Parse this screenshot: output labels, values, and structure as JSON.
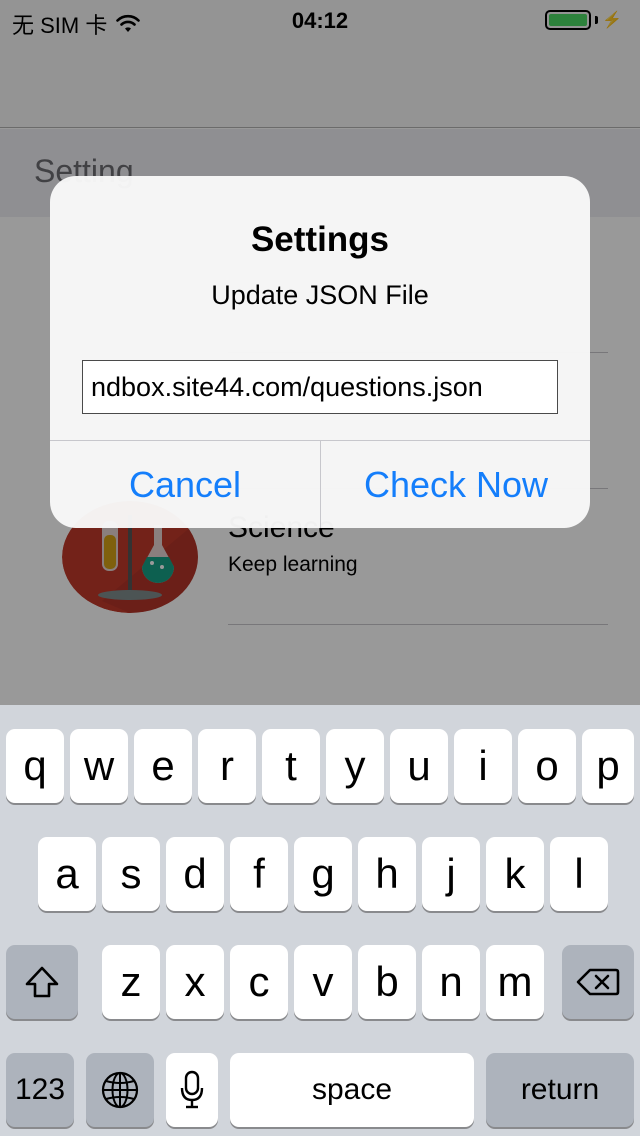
{
  "status_bar": {
    "carrier": "无 SIM 卡",
    "time": "04:12",
    "battery_color": "#4cd964"
  },
  "content": {
    "section_title": "Setting",
    "cells": [
      {
        "title": "Science",
        "subtitle": "Keep learning",
        "icon": "science-lab-icon"
      }
    ]
  },
  "alert": {
    "title": "Settings",
    "message": "Update JSON File",
    "input_value": "ndbox.site44.com/questions.json",
    "cancel_label": "Cancel",
    "confirm_label": "Check Now",
    "accent_color": "#147efb"
  },
  "keyboard": {
    "row1": [
      "q",
      "w",
      "e",
      "r",
      "t",
      "y",
      "u",
      "i",
      "o",
      "p"
    ],
    "row2": [
      "a",
      "s",
      "d",
      "f",
      "g",
      "h",
      "j",
      "k",
      "l"
    ],
    "row3": [
      "z",
      "x",
      "c",
      "v",
      "b",
      "n",
      "m"
    ],
    "numbers_label": "123",
    "space_label": "space",
    "return_label": "return",
    "shift_icon": "shift-icon",
    "delete_icon": "delete-icon",
    "globe_icon": "globe-icon",
    "mic_icon": "microphone-icon"
  }
}
